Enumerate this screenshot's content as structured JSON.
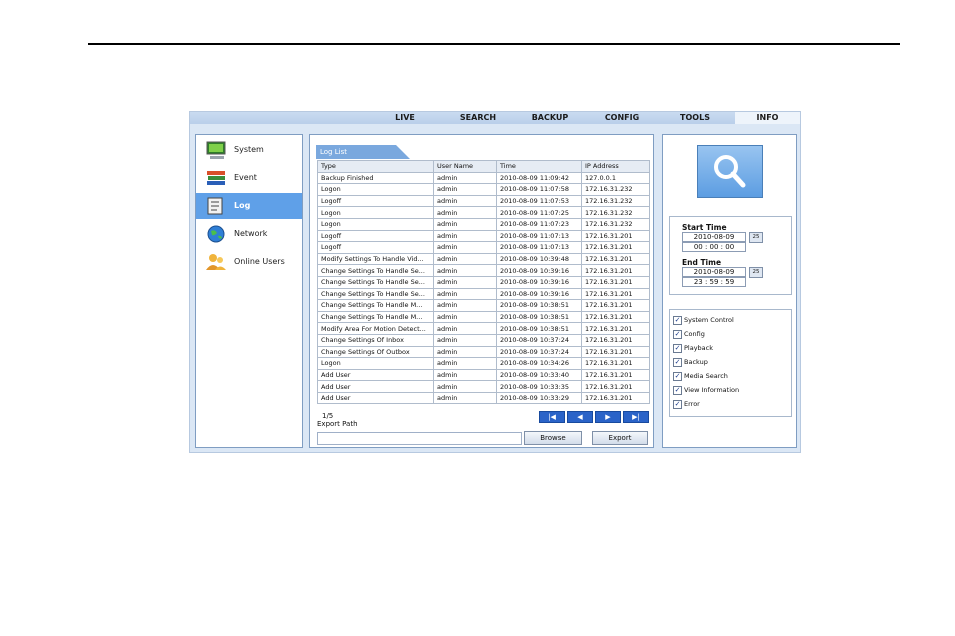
{
  "nav": {
    "items": [
      "LIVE",
      "SEARCH",
      "BACKUP",
      "CONFIG",
      "TOOLS",
      "INFO"
    ],
    "active": "INFO"
  },
  "sidebar": {
    "items": [
      {
        "label": "System",
        "icon": "monitor-icon"
      },
      {
        "label": "Event",
        "icon": "books-icon"
      },
      {
        "label": "Log",
        "icon": "log-icon"
      },
      {
        "label": "Network",
        "icon": "globe-icon"
      },
      {
        "label": "Online Users",
        "icon": "users-icon"
      }
    ],
    "active": "Log"
  },
  "log": {
    "tab": "Log List",
    "columns": [
      "Type",
      "User Name",
      "Time",
      "IP Address"
    ],
    "rows": [
      [
        "Backup Finished",
        "admin",
        "2010-08-09 11:09:42",
        "127.0.0.1"
      ],
      [
        "Logon",
        "admin",
        "2010-08-09 11:07:58",
        "172.16.31.232"
      ],
      [
        "Logoff",
        "admin",
        "2010-08-09 11:07:53",
        "172.16.31.232"
      ],
      [
        "Logon",
        "admin",
        "2010-08-09 11:07:25",
        "172.16.31.232"
      ],
      [
        "Logon",
        "admin",
        "2010-08-09 11:07:23",
        "172.16.31.232"
      ],
      [
        "Logoff",
        "admin",
        "2010-08-09 11:07:13",
        "172.16.31.201"
      ],
      [
        "Logoff",
        "admin",
        "2010-08-09 11:07:13",
        "172.16.31.201"
      ],
      [
        "Modify Settings To Handle Vid...",
        "admin",
        "2010-08-09 10:39:48",
        "172.16.31.201"
      ],
      [
        "Change Settings To Handle Se...",
        "admin",
        "2010-08-09 10:39:16",
        "172.16.31.201"
      ],
      [
        "Change Settings To Handle Se...",
        "admin",
        "2010-08-09 10:39:16",
        "172.16.31.201"
      ],
      [
        "Change Settings To Handle Se...",
        "admin",
        "2010-08-09 10:39:16",
        "172.16.31.201"
      ],
      [
        "Change Settings To Handle M...",
        "admin",
        "2010-08-09 10:38:51",
        "172.16.31.201"
      ],
      [
        "Change Settings To Handle M...",
        "admin",
        "2010-08-09 10:38:51",
        "172.16.31.201"
      ],
      [
        "Modify Area For Motion Detect...",
        "admin",
        "2010-08-09 10:38:51",
        "172.16.31.201"
      ],
      [
        "Change Settings Of Inbox",
        "admin",
        "2010-08-09 10:37:24",
        "172.16.31.201"
      ],
      [
        "Change Settings Of Outbox",
        "admin",
        "2010-08-09 10:37:24",
        "172.16.31.201"
      ],
      [
        "Logon",
        "admin",
        "2010-08-09 10:34:26",
        "172.16.31.201"
      ],
      [
        "Add User",
        "admin",
        "2010-08-09 10:33:40",
        "172.16.31.201"
      ],
      [
        "Add User",
        "admin",
        "2010-08-09 10:33:35",
        "172.16.31.201"
      ],
      [
        "Add User",
        "admin",
        "2010-08-09 10:33:29",
        "172.16.31.201"
      ]
    ],
    "page": "1/5",
    "export_label": "Export Path",
    "export_path": "",
    "browse": "Browse",
    "export": "Export",
    "pager": [
      "|◀",
      "◀",
      "▶",
      "▶|"
    ]
  },
  "search": {
    "start_label": "Start Time",
    "start_date": "2010-08-09",
    "start_time": "00 : 00 : 00",
    "end_label": "End Time",
    "end_date": "2010-08-09",
    "end_time": "23 : 59 : 59",
    "calendar_label": "25"
  },
  "filters": [
    {
      "label": "System Control",
      "checked": true
    },
    {
      "label": "Config",
      "checked": true
    },
    {
      "label": "Playback",
      "checked": true
    },
    {
      "label": "Backup",
      "checked": true
    },
    {
      "label": "Media Search",
      "checked": true
    },
    {
      "label": "View Information",
      "checked": true
    },
    {
      "label": "Error",
      "checked": true
    }
  ],
  "colors": {
    "accent": "#5fa0e8",
    "nav_bg": "#c9dbf0",
    "page_btn": "#2a63c8"
  }
}
